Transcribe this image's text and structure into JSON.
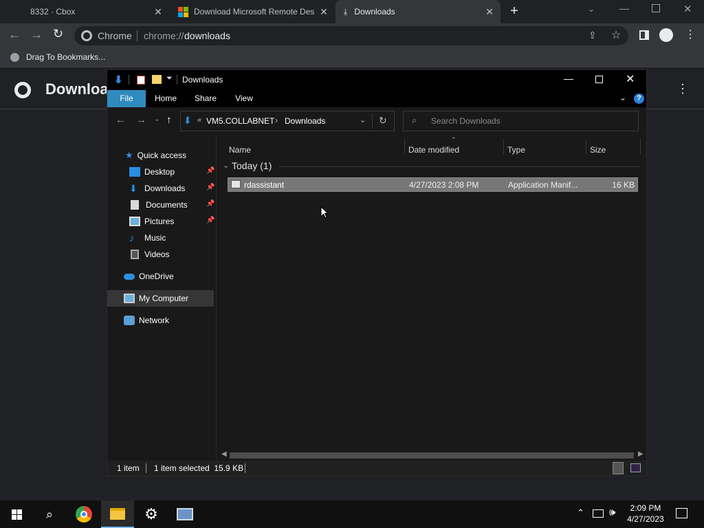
{
  "browser": {
    "tabs": [
      {
        "label": "8332 · Cbox"
      },
      {
        "label": "Download Microsoft Remote Des"
      },
      {
        "label": "Downloads"
      }
    ],
    "new_tab": "+",
    "omnibox": {
      "site": "Chrome",
      "url_prefix": "chrome://",
      "url_path": "downloads"
    },
    "bookmarks_bar": {
      "item": "Drag To Bookmarks..."
    },
    "page_title": "Downloads"
  },
  "explorer": {
    "title": "Downloads",
    "ribbon_tabs": [
      "File",
      "Home",
      "Share",
      "View"
    ],
    "breadcrumb": {
      "overflow": "«",
      "root": "VM5.COLLABNET",
      "separator": "›",
      "current": "Downloads"
    },
    "search_placeholder": "Search Downloads",
    "nav": {
      "quick_access": "Quick access",
      "items": [
        "Desktop",
        "Downloads",
        "Documents",
        "Pictures",
        "Music",
        "Videos"
      ],
      "onedrive": "OneDrive",
      "my_computer": "My Computer",
      "network": "Network"
    },
    "columns": {
      "name": "Name",
      "date": "Date modified",
      "type": "Type",
      "size": "Size"
    },
    "group": "Today (1)",
    "files": [
      {
        "name": "rdassistant",
        "date": "4/27/2023 2:08 PM",
        "type": "Application Manif...",
        "size": "16 KB"
      }
    ],
    "status": {
      "count": "1 item",
      "selected": "1 item selected  15.9 KB"
    }
  },
  "taskbar": {
    "time": "2:09 PM",
    "date": "4/27/2023"
  },
  "colors": {
    "accent": "#1a73e8",
    "file_tab": "#2f8bbf",
    "selection": "#777777"
  }
}
